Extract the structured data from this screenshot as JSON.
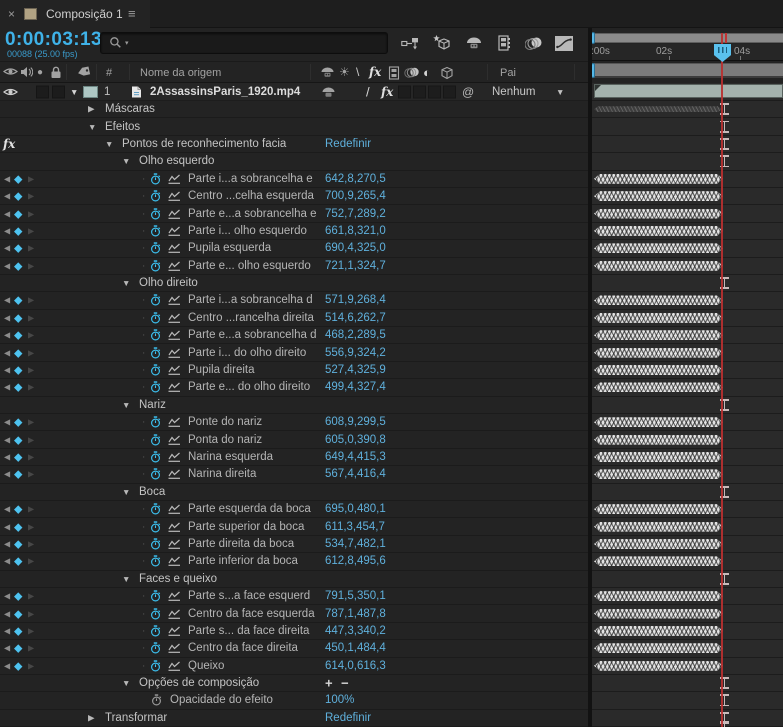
{
  "tab": {
    "close": "×",
    "title": "Composição 1",
    "menu": "≡"
  },
  "toolbar": {
    "timecode": "0:00:03:13",
    "frame_info": "00088 (25.00 fps)",
    "search_placeholder": "",
    "icons": [
      "composition-mini-flowchart-icon",
      "draft-3d-icon",
      "shy-layers-icon",
      "frame-blending-icon",
      "motion-blur-icon",
      "graph-editor-icon"
    ]
  },
  "columns": {
    "icons": [
      "video-eye-icon",
      "audio-speaker-icon",
      "solo-icon",
      "lock-icon",
      "label-icon"
    ],
    "number": "#",
    "source_name": "Nome da origem",
    "switch_icons": [
      "shy-icon",
      "collapse-sun-icon",
      "quality-icon",
      "fx-icon",
      "frame-blend-icon",
      "motion-blur-icon",
      "adjustment-layer-icon",
      "cube-3d-icon"
    ],
    "parent": "Pai"
  },
  "layer": {
    "index": "1",
    "name": "2AssassinsParis_1920.mp4",
    "quality": "/",
    "fx": "fx",
    "parent_value": "Nenhum"
  },
  "ruler": {
    "ticks": [
      ":00s",
      "02s",
      "04s"
    ]
  },
  "glyphs": {
    "open": "▼",
    "closed": "▶",
    "kf_prev": "◀",
    "kf_diamond": "◆",
    "kf_next": "▶",
    "plus": "+",
    "minus": "−",
    "dot": "·",
    "fx": "fx",
    "at": "@",
    "slash_header": "\\",
    "adj": "◐",
    "sun": "☀",
    "solo": "●",
    "dropdown": "▼",
    "search_caret": "▾"
  },
  "rows": [
    {
      "k": "group",
      "a": "c",
      "in": 1,
      "t": "Máscaras",
      "tl": "dark"
    },
    {
      "k": "group",
      "a": "o",
      "in": 1,
      "t": "Efeitos",
      "tl": "ibeam"
    },
    {
      "k": "group",
      "a": "o",
      "in": 2,
      "t": "Pontos de reconhecimento facia",
      "v": "Redefinir",
      "vk": "link",
      "fx": true,
      "tl": "ibeam"
    },
    {
      "k": "group",
      "a": "o",
      "in": 3,
      "t": "Olho esquerdo",
      "tl": "ibeam"
    },
    {
      "k": "prop",
      "t": "Parte i...a sobrancelha e",
      "v": "642,8,270,5",
      "tl": "band"
    },
    {
      "k": "prop",
      "t": "Centro ...celha esquerda",
      "v": "700,9,265,4",
      "tl": "band"
    },
    {
      "k": "prop",
      "t": "Parte e...a sobrancelha e",
      "v": "752,7,289,2",
      "tl": "band"
    },
    {
      "k": "prop",
      "t": "Parte i... olho esquerdo",
      "v": "661,8,321,0",
      "tl": "band"
    },
    {
      "k": "prop",
      "t": "Pupila esquerda",
      "v": "690,4,325,0",
      "tl": "band"
    },
    {
      "k": "prop",
      "t": "Parte e... olho esquerdo",
      "v": "721,1,324,7",
      "tl": "band"
    },
    {
      "k": "group",
      "a": "o",
      "in": 3,
      "t": "Olho direito",
      "tl": "ibeam"
    },
    {
      "k": "prop",
      "t": "Parte i...a sobrancelha d",
      "v": "571,9,268,4",
      "tl": "band"
    },
    {
      "k": "prop",
      "t": "Centro ...rancelha direita",
      "v": "514,6,262,7",
      "tl": "band"
    },
    {
      "k": "prop",
      "t": "Parte e...a sobrancelha d",
      "v": "468,2,289,5",
      "tl": "band"
    },
    {
      "k": "prop",
      "t": "Parte i... do olho direito",
      "v": "556,9,324,2",
      "tl": "band"
    },
    {
      "k": "prop",
      "t": "Pupila direita",
      "v": "527,4,325,9",
      "tl": "band"
    },
    {
      "k": "prop",
      "t": "Parte e... do olho direito",
      "v": "499,4,327,4",
      "tl": "band"
    },
    {
      "k": "group",
      "a": "o",
      "in": 3,
      "t": "Nariz",
      "tl": "ibeam"
    },
    {
      "k": "prop",
      "t": "Ponte do nariz",
      "v": "608,9,299,5",
      "tl": "band"
    },
    {
      "k": "prop",
      "t": "Ponta do nariz",
      "v": "605,0,390,8",
      "tl": "band"
    },
    {
      "k": "prop",
      "t": "Narina esquerda",
      "v": "649,4,415,3",
      "tl": "band"
    },
    {
      "k": "prop",
      "t": "Narina direita",
      "v": "567,4,416,4",
      "tl": "band"
    },
    {
      "k": "group",
      "a": "o",
      "in": 3,
      "t": "Boca",
      "tl": "ibeam"
    },
    {
      "k": "prop",
      "t": "Parte esquerda da boca",
      "v": "695,0,480,1",
      "tl": "band"
    },
    {
      "k": "prop",
      "t": "Parte superior da boca",
      "v": "611,3,454,7",
      "tl": "band"
    },
    {
      "k": "prop",
      "t": "Parte direita da boca",
      "v": "534,7,482,1",
      "tl": "band"
    },
    {
      "k": "prop",
      "t": "Parte inferior da boca",
      "v": "612,8,495,6",
      "tl": "band"
    },
    {
      "k": "group",
      "a": "o",
      "in": 3,
      "t": "Faces e queixo",
      "tl": "ibeam"
    },
    {
      "k": "prop",
      "t": "Parte s...a face esquerd",
      "v": "791,5,350,1",
      "tl": "band"
    },
    {
      "k": "prop",
      "t": "Centro da face esquerda",
      "v": "787,1,487,8",
      "tl": "band"
    },
    {
      "k": "prop",
      "t": "Parte s... da face direita",
      "v": "447,3,340,2",
      "tl": "band"
    },
    {
      "k": "prop",
      "t": "Centro da face direita",
      "v": "450,1,484,4",
      "tl": "band"
    },
    {
      "k": "prop",
      "t": "Queixo",
      "v": "614,0,616,3",
      "tl": "band"
    },
    {
      "k": "group",
      "a": "o",
      "in": 3,
      "t": "Opções de composição",
      "vk": "plusminus",
      "tl": "ibeam"
    },
    {
      "k": "static",
      "t": "Opacidade do efeito",
      "v": "100%",
      "tl": "ibeam"
    },
    {
      "k": "group",
      "a": "c",
      "in": 1,
      "t": "Transformar",
      "v": "Redefinir",
      "vk": "link",
      "tl": "ibeam"
    },
    {
      "k": "empty",
      "tl": "ibeam"
    }
  ],
  "colors": {
    "accent_blue": "#3fb2e8",
    "value_blue": "#5fb0dc",
    "keyframe_cyan": "#4ec3f0",
    "playhead_red": "#b93030",
    "layer_bar": "#a4b2ad",
    "label_tan": "#b1a283",
    "layer_swatch": "#aec7c4"
  }
}
